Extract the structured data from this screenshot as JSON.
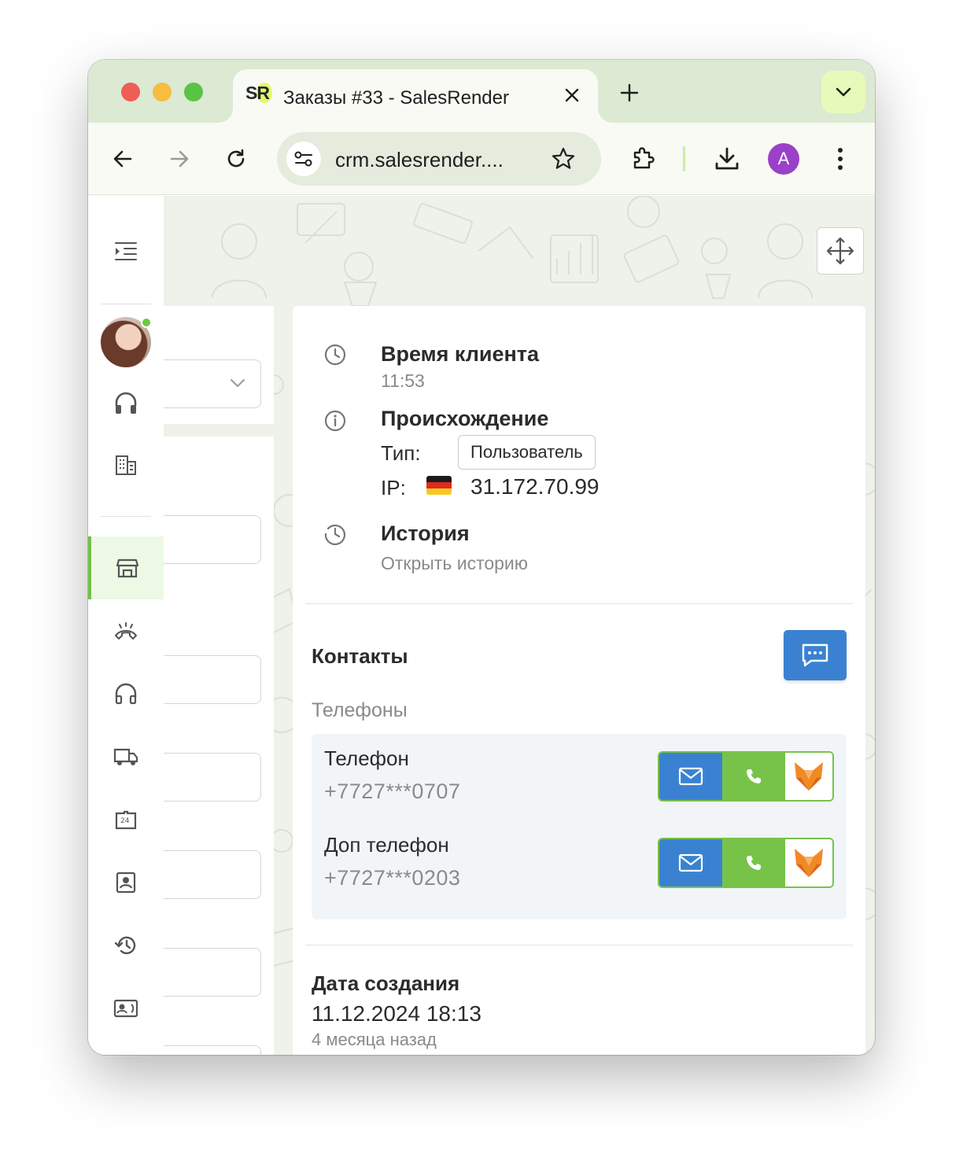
{
  "browser": {
    "tab_title": "Заказы #33 - SalesRender",
    "favicon_text": "SR",
    "url": "crm.salesrender....",
    "profile_initial": "A"
  },
  "info": {
    "client_time_title": "Время клиента",
    "client_time_value": "11:53",
    "origin_title": "Происхождение",
    "type_label": "Тип:",
    "type_value": "Пользователь",
    "ip_label": "IP:",
    "ip_value": "31.172.70.99",
    "history_title": "История",
    "history_link": "Открыть историю"
  },
  "contacts": {
    "title": "Контакты",
    "phones_title": "Телефоны",
    "phones": [
      {
        "label": "Телефон",
        "number": "+7727***0707"
      },
      {
        "label": "Доп телефон",
        "number": "+7727***0203"
      }
    ]
  },
  "created": {
    "title": "Дата создания",
    "datetime": "11.12.2024 18:13",
    "relative": "4 месяца назад"
  },
  "colors": {
    "accent_green": "#77c34a",
    "accent_blue": "#3a82d1"
  }
}
